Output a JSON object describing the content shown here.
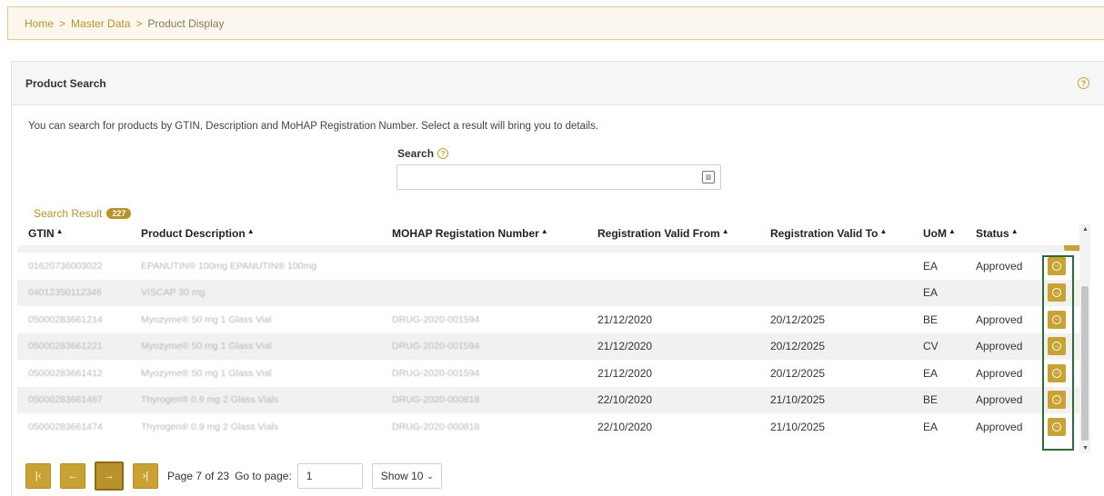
{
  "breadcrumb": {
    "items": [
      "Home",
      "Master Data",
      "Product Display"
    ],
    "separator": ">"
  },
  "panel": {
    "title": "Product Search",
    "help_icon": "?",
    "intro": "You can search for products by GTIN, Description and MoHAP Registration Number. Select a result will bring you to details."
  },
  "search": {
    "label": "Search",
    "help_icon": "?",
    "value": "",
    "placeholder": "",
    "scan_icon": "barcode-scan-icon"
  },
  "results": {
    "label": "Search Result",
    "count": "227",
    "columns": [
      "GTIN",
      "Product Description",
      "MOHAP Registation Number",
      "Registration Valid From",
      "Registration Valid To",
      "UoM",
      "Status"
    ],
    "sort_glyph": "▲",
    "action_glyph": "→",
    "rows": [
      {
        "gtin": "01620736003022",
        "desc": "EPANUTIN® 100mg EPANUTIN® 100mg",
        "reg": "",
        "from": "",
        "to": "",
        "uom": "EA",
        "status": "Approved"
      },
      {
        "gtin": "04012350112346",
        "desc": "VISCAP 30 mg",
        "reg": "",
        "from": "",
        "to": "",
        "uom": "EA",
        "status": ""
      },
      {
        "gtin": "05000283661214",
        "desc": "Myozyme® 50 mg 1 Glass Vial",
        "reg": "DRUG-2020-001594",
        "from": "21/12/2020",
        "to": "20/12/2025",
        "uom": "BE",
        "status": "Approved"
      },
      {
        "gtin": "05000283661221",
        "desc": "Myozyme® 50 mg 1 Glass Vial",
        "reg": "DRUG-2020-001594",
        "from": "21/12/2020",
        "to": "20/12/2025",
        "uom": "CV",
        "status": "Approved"
      },
      {
        "gtin": "05000283661412",
        "desc": "Myozyme® 50 mg 1 Glass Vial",
        "reg": "DRUG-2020-001594",
        "from": "21/12/2020",
        "to": "20/12/2025",
        "uom": "EA",
        "status": "Approved"
      },
      {
        "gtin": "05000283661467",
        "desc": "Thyrogen® 0.9 mg 2 Glass Vials",
        "reg": "DRUG-2020-000818",
        "from": "22/10/2020",
        "to": "21/10/2025",
        "uom": "BE",
        "status": "Approved"
      },
      {
        "gtin": "05000283661474",
        "desc": "Thyrogen® 0.9 mg 2 Glass Vials",
        "reg": "DRUG-2020-000818",
        "from": "22/10/2020",
        "to": "21/10/2025",
        "uom": "EA",
        "status": "Approved"
      }
    ]
  },
  "pager": {
    "first": "|‹",
    "prev": "←",
    "next": "→",
    "last": "›|",
    "page_info": "Page 7 of 23",
    "goto_label": "Go to page:",
    "goto_value": "1",
    "show_option": "Show 10"
  },
  "colors": {
    "accent": "#c9a234",
    "link": "#b8922a",
    "highlight_border": "#2f6b3a"
  }
}
